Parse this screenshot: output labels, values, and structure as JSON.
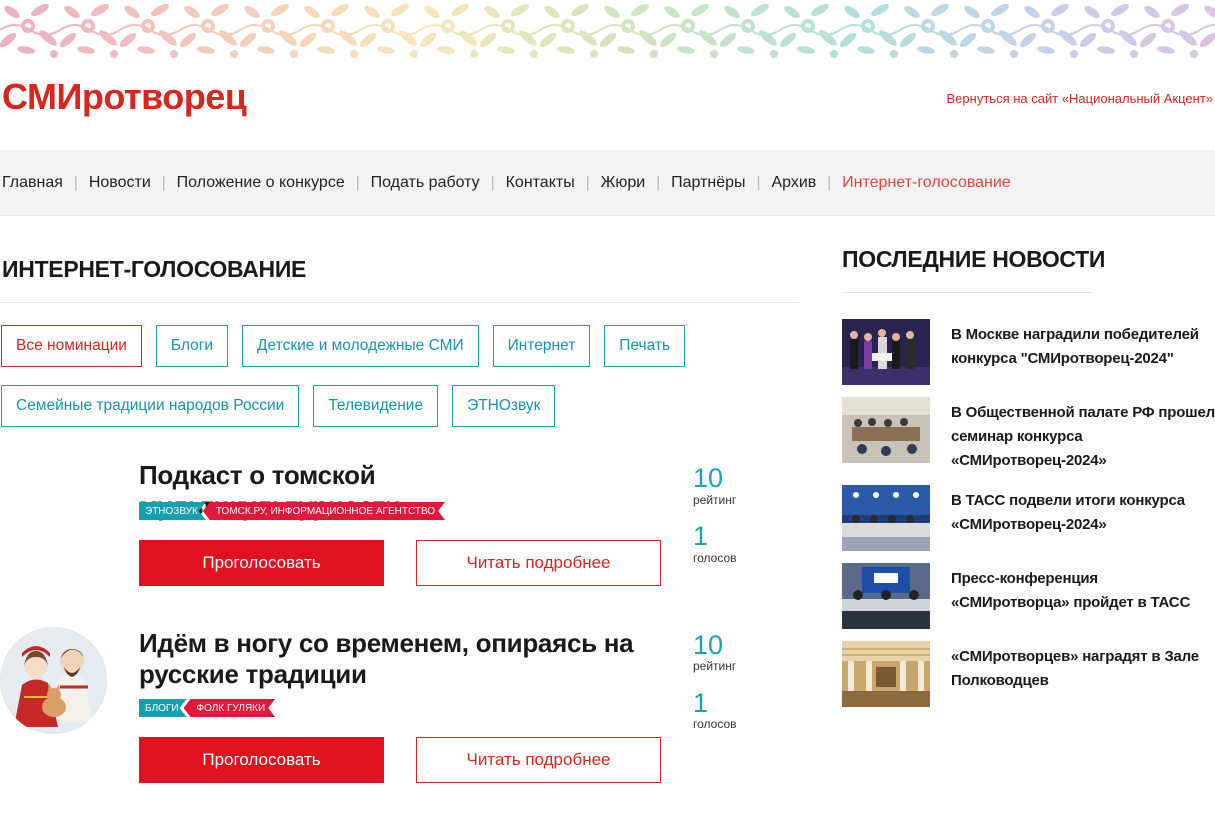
{
  "header": {
    "logo": "СМИротворец",
    "back_link": "Вернуться на сайт «Национальный Акцент»"
  },
  "nav": {
    "items": [
      "Главная",
      "Новости",
      "Положение о конкурсе",
      "Подать работу",
      "Контакты",
      "Жюри",
      "Партнёры",
      "Архив",
      "Интернет-голосование"
    ],
    "active_index": 8
  },
  "main": {
    "section_title": "ИНТЕРНЕТ-ГОЛОСОВАНИЕ",
    "filters": [
      "Все номинации",
      "Блоги",
      "Детские и молодежные СМИ",
      "Интернет",
      "Печать",
      "Семейные традиции народов России",
      "Телевидение",
      "ЭТНОзвук"
    ],
    "active_filter_index": 0,
    "entries": [
      {
        "title": "Подкаст о томской мультикультурности",
        "tag_category": "ЭТНОЗВУК",
        "tag_author": "ТОМСК.РУ, ИНФОРМАЦИОННОЕ АГЕНТСТВО",
        "vote_label": "Проголосовать",
        "read_label": "Читать подробнее",
        "rating": "10",
        "rating_label": "рейтинг",
        "votes": "1",
        "votes_label": "голосов",
        "has_avatar": false
      },
      {
        "title": "Идём в ногу со временем, опираясь на русские традиции",
        "tag_category": "БЛОГИ",
        "tag_author": "ФОЛК ГУЛЯКИ",
        "vote_label": "Проголосовать",
        "read_label": "Читать подробнее",
        "rating": "10",
        "rating_label": "рейтинг",
        "votes": "1",
        "votes_label": "голосов",
        "has_avatar": true
      }
    ]
  },
  "sidebar": {
    "title": "ПОСЛЕДНИЕ НОВОСТИ",
    "news": [
      "В Москве наградили победителей конкурса \"СМИротворец-2024\"",
      "В Общественной палате РФ прошел семинар конкурса «СМИротворец-2024»",
      "В ТАСС подвели итоги конкурса «СМИротворец-2024»",
      "Пресс-конференция «СМИротворца» пройдет в ТАСС",
      "«СМИротворцев» наградят в Зале Полководцев"
    ]
  },
  "colors": {
    "brand_red": "#d8261c",
    "vote_red": "#e3101f",
    "teal": "#1aa3b5",
    "nav_bg": "#f3f3f3"
  },
  "icons": {
    "banner": "folk-ornament",
    "avatar": "folk-couple-illustration"
  }
}
